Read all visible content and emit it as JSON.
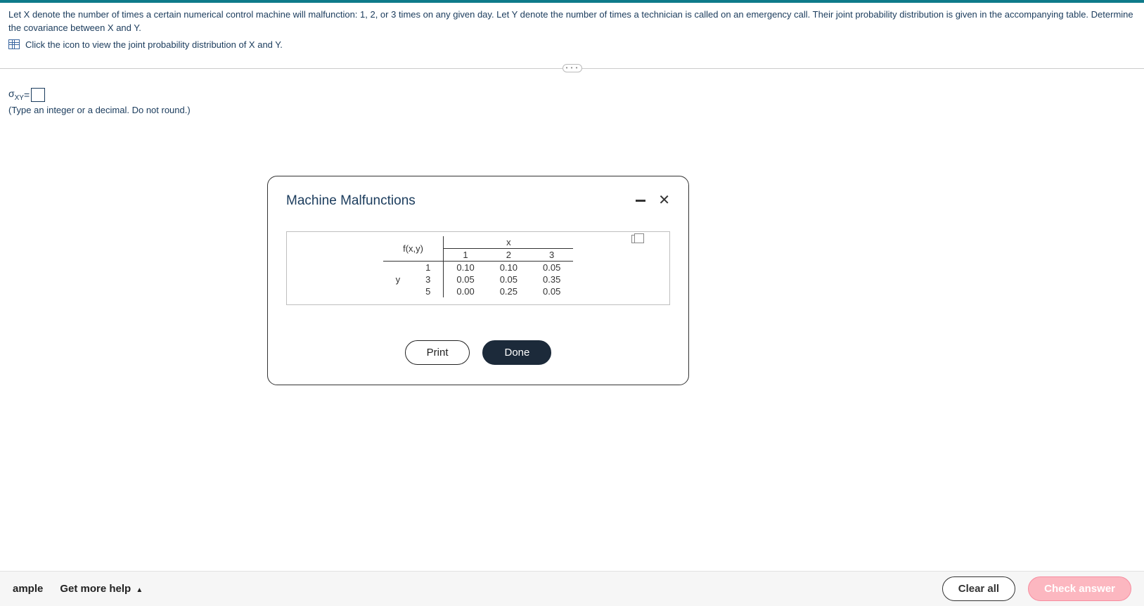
{
  "question": {
    "text": "Let X denote the number of times a certain numerical control machine will malfunction: 1, 2, or 3 times on any given day. Let Y denote the number of times a technician is called on an emergency call. Their joint probability distribution is given in the accompanying table. Determine the covariance between X and Y.",
    "link_text": "Click the icon to view the joint probability distribution of X and Y."
  },
  "answer": {
    "sigma_label_html": "σ",
    "sigma_sub": "XY",
    "equals": " = ",
    "value": "",
    "hint": "(Type an integer or a decimal. Do not round.)"
  },
  "modal": {
    "title": "Machine Malfunctions",
    "fxy": "f(x,y)",
    "x_label": "x",
    "y_label": "y",
    "x_vals": [
      "1",
      "2",
      "3"
    ],
    "y_vals": [
      "1",
      "3",
      "5"
    ],
    "rows": [
      [
        "0.10",
        "0.10",
        "0.05"
      ],
      [
        "0.05",
        "0.05",
        "0.35"
      ],
      [
        "0.00",
        "0.25",
        "0.05"
      ]
    ],
    "print": "Print",
    "done": "Done"
  },
  "footer": {
    "example": "ample",
    "more_help": "Get more help",
    "clear": "Clear all",
    "check": "Check answer"
  },
  "divider_dots": "• • •",
  "chart_data": {
    "type": "table",
    "title": "Machine Malfunctions — joint probability distribution f(x,y)",
    "x_values": [
      1,
      2,
      3
    ],
    "y_values": [
      1,
      3,
      5
    ],
    "matrix": [
      [
        0.1,
        0.1,
        0.05
      ],
      [
        0.05,
        0.05,
        0.35
      ],
      [
        0.0,
        0.25,
        0.05
      ]
    ]
  }
}
